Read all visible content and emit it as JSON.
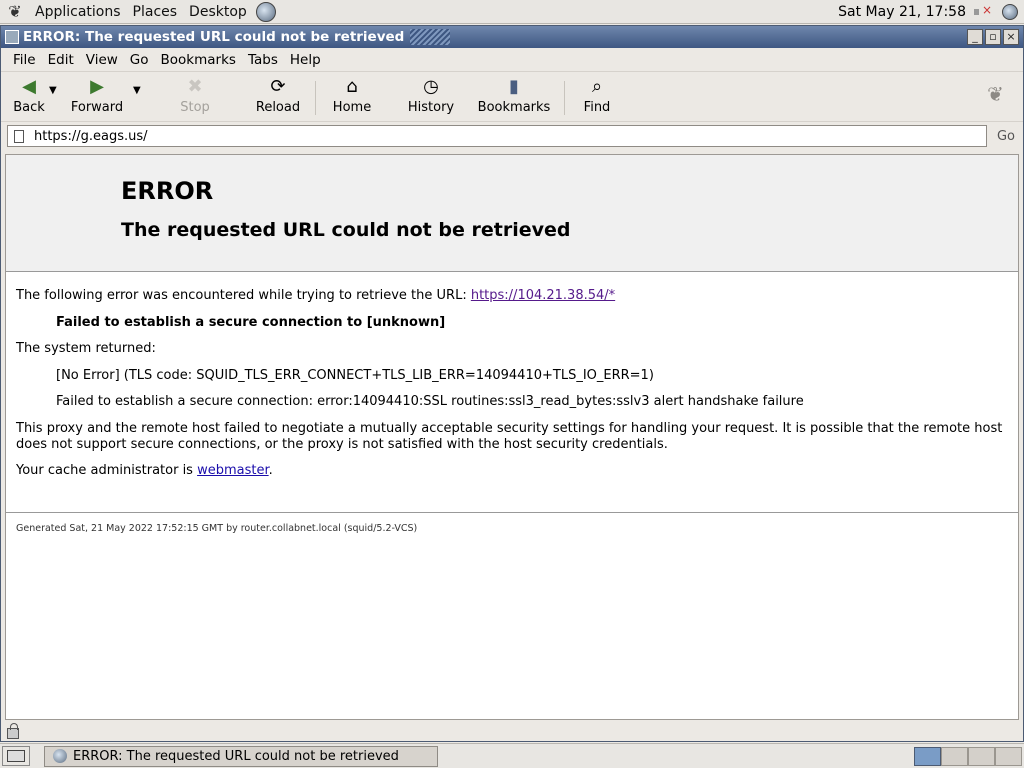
{
  "top_panel": {
    "menus": [
      "Applications",
      "Places",
      "Desktop"
    ],
    "clock": "Sat May 21, 17:58"
  },
  "window": {
    "title": "ERROR: The requested URL could not be retrieved"
  },
  "menubar": {
    "items": [
      "File",
      "Edit",
      "View",
      "Go",
      "Bookmarks",
      "Tabs",
      "Help"
    ]
  },
  "toolbar": {
    "back": "Back",
    "forward": "Forward",
    "stop": "Stop",
    "reload": "Reload",
    "home": "Home",
    "history": "History",
    "bookmarks": "Bookmarks",
    "find": "Find"
  },
  "location": {
    "url": "https://g.eags.us/",
    "go": "Go"
  },
  "page": {
    "heading": "ERROR",
    "subheading": "The requested URL could not be retrieved",
    "intro": "The following error was encountered while trying to retrieve the URL: ",
    "intro_link": "https://104.21.38.54/*",
    "failure": "Failed to establish a secure connection to [unknown]",
    "system_returned": "The system returned:",
    "tls_code": "[No Error] (TLS code: SQUID_TLS_ERR_CONNECT+TLS_LIB_ERR=14094410+TLS_IO_ERR=1)",
    "ssl_error": "Failed to establish a secure connection: error:14094410:SSL routines:ssl3_read_bytes:sslv3 alert handshake failure",
    "explanation": "This proxy and the remote host failed to negotiate a mutually acceptable security settings for handling your request. It is possible that the remote host does not support secure connections, or the proxy is not satisfied with the host security credentials.",
    "admin_prefix": "Your cache administrator is ",
    "admin_link": "webmaster",
    "admin_suffix": ".",
    "footer": "Generated Sat, 21 May 2022 17:52:15 GMT by router.collabnet.local (squid/5.2-VCS)"
  },
  "taskbar": {
    "task": "ERROR: The requested URL could not be retrieved"
  }
}
